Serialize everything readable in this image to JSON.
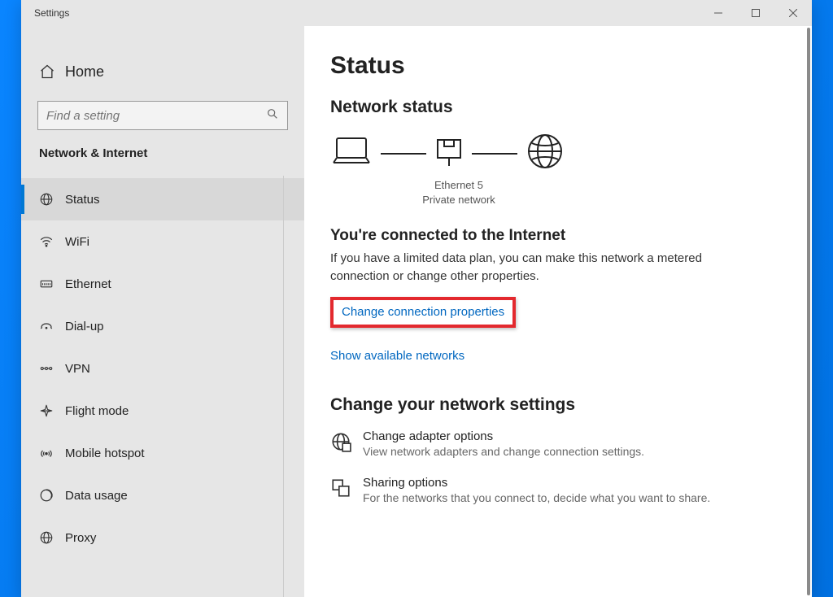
{
  "window": {
    "title": "Settings"
  },
  "sidebar": {
    "home_label": "Home",
    "search_placeholder": "Find a setting",
    "category": "Network & Internet",
    "items": [
      {
        "label": "Status"
      },
      {
        "label": "WiFi"
      },
      {
        "label": "Ethernet"
      },
      {
        "label": "Dial-up"
      },
      {
        "label": "VPN"
      },
      {
        "label": "Flight mode"
      },
      {
        "label": "Mobile hotspot"
      },
      {
        "label": "Data usage"
      },
      {
        "label": "Proxy"
      }
    ]
  },
  "main": {
    "heading": "Status",
    "section1_heading": "Network status",
    "connection_name": "Ethernet 5",
    "connection_type": "Private network",
    "connected_heading": "You're connected to the Internet",
    "connected_desc": "If you have a limited data plan, you can make this network a metered connection or change other properties.",
    "link_change_props": "Change connection properties",
    "link_show_networks": "Show available networks",
    "section2_heading": "Change your network settings",
    "settings": [
      {
        "title": "Change adapter options",
        "sub": "View network adapters and change connection settings."
      },
      {
        "title": "Sharing options",
        "sub": "For the networks that you connect to, decide what you want to share."
      }
    ]
  }
}
